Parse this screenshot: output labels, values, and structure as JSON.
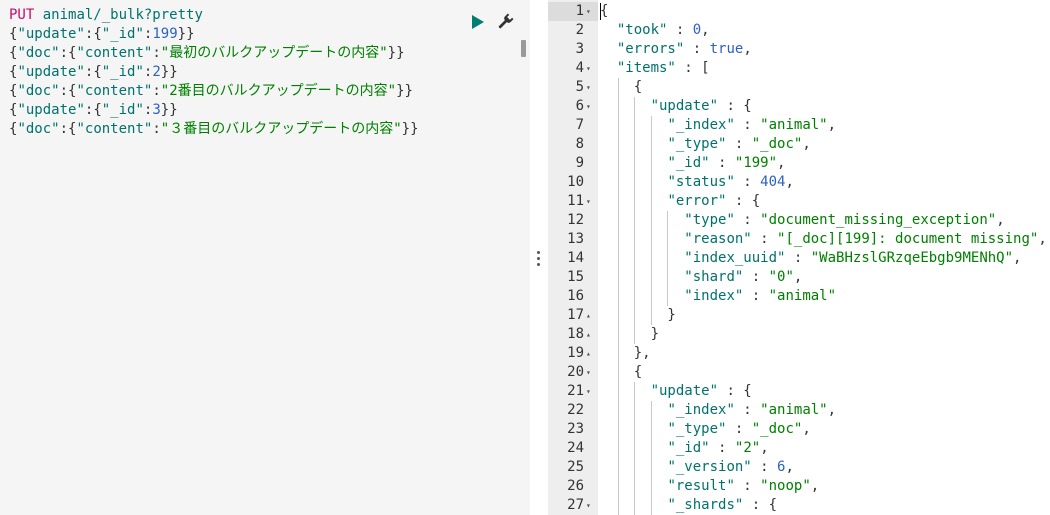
{
  "request": {
    "method": "PUT",
    "endpoint": "animal/_bulk?pretty",
    "lines": [
      "{\"update\":{\"_id\":199}}",
      "{\"doc\":{\"content\":\"最初のバルクアップデートの内容\"}}",
      "{\"update\":{\"_id\":2}}",
      "{\"doc\":{\"content\":\"2番目のバルクアップデートの内容\"}}",
      "{\"update\":{\"_id\":3}}",
      "{\"doc\":{\"content\":\"３番目のバルクアップデートの内容\"}}"
    ]
  },
  "response": {
    "line_numbers": [
      "1",
      "2",
      "3",
      "4",
      "5",
      "6",
      "7",
      "8",
      "9",
      "10",
      "11",
      "12",
      "13",
      "14",
      "15",
      "16",
      "17",
      "18",
      "19",
      "20",
      "21",
      "22",
      "23",
      "24",
      "25",
      "26",
      "27"
    ],
    "lines": [
      "{",
      "  \"took\" : 0,",
      "  \"errors\" : true,",
      "  \"items\" : [",
      "    {",
      "      \"update\" : {",
      "        \"_index\" : \"animal\",",
      "        \"_type\" : \"_doc\",",
      "        \"_id\" : \"199\",",
      "        \"status\" : 404,",
      "        \"error\" : {",
      "          \"type\" : \"document_missing_exception\",",
      "          \"reason\" : \"[_doc][199]: document missing\",",
      "          \"index_uuid\" : \"WaBHzslGRzqeEbgb9MENhQ\",",
      "          \"shard\" : \"0\",",
      "          \"index\" : \"animal\"",
      "        }",
      "      }",
      "    },",
      "    {",
      "      \"update\" : {",
      "        \"_index\" : \"animal\",",
      "        \"_type\" : \"_doc\",",
      "        \"_id\" : \"2\",",
      "        \"_version\" : 6,",
      "        \"result\" : \"noop\",",
      "        \"_shards\" : {"
    ]
  },
  "icons": {
    "run": "play-icon",
    "settings": "wrench-icon",
    "resize": "vertical-dots-icon",
    "fold_open": "fold-down-icon",
    "fold_close": "fold-up-icon"
  },
  "colors": {
    "method": "#c80a68",
    "key": "#00726e",
    "string": "#008000",
    "number": "#2d61c2",
    "run_button": "#017d73"
  }
}
